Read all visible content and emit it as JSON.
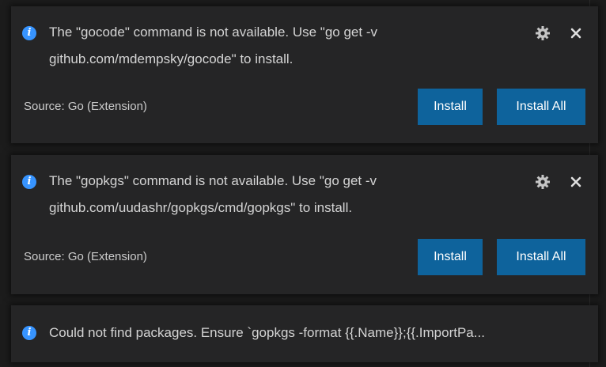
{
  "notifications": [
    {
      "icon": "info-icon",
      "message_line1": "The \"gocode\" command is not available. Use \"go get -v",
      "message_line2": "github.com/mdempsky/gocode\" to install.",
      "source": "Source: Go (Extension)",
      "buttons": [
        "Install",
        "Install All"
      ]
    },
    {
      "icon": "info-icon",
      "message_line1": "The \"gopkgs\" command is not available. Use \"go get -v",
      "message_line2": "github.com/uudashr/gopkgs/cmd/gopkgs\" to install.",
      "source": "Source: Go (Extension)",
      "buttons": [
        "Install",
        "Install All"
      ]
    },
    {
      "icon": "info-icon",
      "message": "Could not find packages. Ensure `gopkgs -format {{.Name}};{{.ImportPa..."
    }
  ],
  "colors": {
    "accent": "#3794ff",
    "button_bg": "#0e639c",
    "toast_bg": "#252526",
    "background": "#1c1c1c"
  },
  "icons": {
    "info": "i",
    "settings": "gear-icon",
    "close": "close-icon"
  }
}
